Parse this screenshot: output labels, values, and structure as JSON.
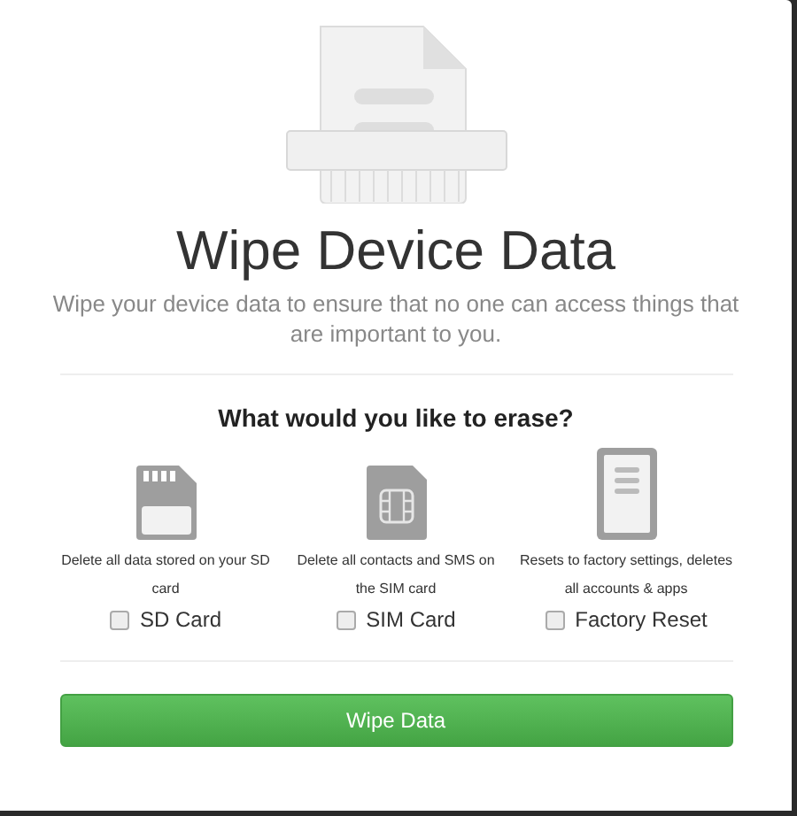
{
  "dialog": {
    "title": "Wipe Device Data",
    "description": "Wipe your device data to ensure that no one can access things that are important to you.",
    "question": "What would you like to erase?",
    "options": [
      {
        "kind": "sd-card",
        "description": "Delete all data stored on your SD card",
        "label": "SD Card",
        "checked": false
      },
      {
        "kind": "sim-card",
        "description": "Delete all contacts and SMS on the SIM card",
        "label": "SIM Card",
        "checked": false
      },
      {
        "kind": "phone",
        "description": "Resets to factory settings, deletes all accounts & apps",
        "label": "Factory Reset",
        "checked": false
      }
    ],
    "button": "Wipe Data"
  }
}
